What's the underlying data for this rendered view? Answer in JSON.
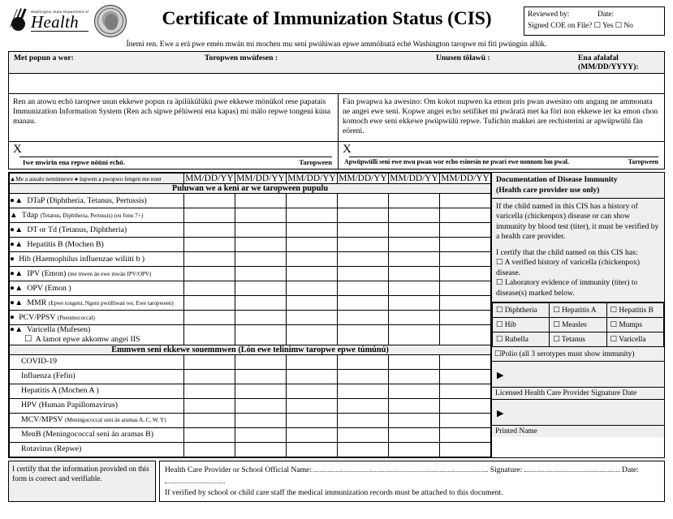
{
  "header": {
    "logo_dept": "Washington State Department of",
    "logo_name": "Health",
    "title": "Certificate of Immunization Status (CIS)",
    "subtitle": "Ínemi ren. Ewe a erá pwe emén mwán mi mochen mu seni pwúlúwan epwe ammólnatá eché Washington taropwe mi fiti pwúngún allúk.",
    "review_by_label": "Reviewed by:",
    "review_date_label": "Date:",
    "signed_coe_label": "Signed COE on File?",
    "yes_label": "Yes",
    "no_label": "No"
  },
  "form_fields": {
    "label_1": "Met popun a wor:",
    "label_2": "Toropwen mwúfesen :",
    "label_3": "Unusen tölawü :",
    "label_4": "Ena afalafal (MM/DD/YYYY):"
  },
  "attestations": {
    "left_paragraph": "Ren an atowu echö taropwe usun ekkewe popun ra äpilükülükü pwe ekkewe mönükol rese papatais Immunization Information System (Ren ach sipwe pélúweni ena kapas) mi mälo repwe tongeni kúna manau.",
    "right_paragraph": "Fän pwapwa ka awesino: Om kokot nupwen ka emon pris pwan awesino om angang ne ammonata ne angei ewe seni. Kopwe angei echo setifiket mi pwäratä met ka föri non ekkewe ier ka emon chon komoch ewe seni ekkewe pwüpwülü repwe. Tufichin makkei are rechisterini ar apwüpwülü fän eöreni.",
    "sig_x": "X",
    "left_sig_caption": "Iwe mwirin ena repwe nöüni echö.",
    "left_sig_date": "Taropween",
    "right_sig_caption": "Apwüpwülli seni ewe nwu pwan wor echo esinesin ne pwari ewe nonnom lon pwal.",
    "right_sig_date": "Taropween"
  },
  "vaccine_table": {
    "legend": "▲Me a asualo neminnewe   ● lupwen a pwopwo fengen me nour",
    "date_headers": [
      "MM/DD/YY",
      "MM/DD/YY",
      "MM/DD/YY",
      "MM/DD/YY",
      "MM/DD/YY",
      "MM/DD/YY"
    ],
    "section_required": "Puluwan we a keni ar we taropween pupulu",
    "section_other": "Emmwen seni ekkewe souemmwen (Lón ewe telinimw taropwe epwe túmúnú)",
    "required_rows": [
      {
        "marks": "●▲",
        "name": "DTaP",
        "detail": "(Diphtheria, Tetanus, Pertussis)",
        "detail_small": ""
      },
      {
        "marks": "▲",
        "name": "Tdap",
        "detail": "",
        "detail_small": "(Tetanus, Diphtheria, Pertussis) (eu fonu 7+)"
      },
      {
        "marks": "●▲",
        "name": "DT or Td",
        "detail": "(Tetanus, Diphtheria)",
        "detail_small": ""
      },
      {
        "marks": "●▲",
        "name": "Hepatitis B",
        "detail": "(Mochen B)",
        "detail_small": ""
      },
      {
        "marks": "●",
        "name": "Hib",
        "detail": "(Haemophilus influenzae wiliiti b )",
        "detail_small": ""
      },
      {
        "marks": "●▲",
        "name": "IPV",
        "detail": "(Emon)",
        "detail_small": "(me mwen án ewe mwán IPV/OPV)"
      },
      {
        "marks": "●▲",
        "name": "OPV",
        "detail": "(Emon )",
        "detail_small": ""
      },
      {
        "marks": "●▲",
        "name": "MMR",
        "detail": "",
        "detail_small": "(Epwe tongeni, Ngeni pwúlliwan we, Ewe taropween)"
      },
      {
        "marks": "●",
        "name": "PCV/PPSV",
        "detail": "",
        "detail_small": "(Pneumococcal)"
      },
      {
        "marks": "●▲",
        "name": "Varicella",
        "detail": "(Mufesen)",
        "detail_small": ""
      }
    ],
    "varicella_subcheck": "A lamot epwe akkomw angei IIS",
    "other_rows": [
      {
        "name": "COVID-19",
        "detail": "",
        "detail_small": ""
      },
      {
        "name": "Influenza",
        "detail": "(Fefin)",
        "detail_small": ""
      },
      {
        "name": "Hepatitis A",
        "detail": "(Mochen A )",
        "detail_small": ""
      },
      {
        "name": "HPV",
        "detail": "(Human Papillomavirus)",
        "detail_small": ""
      },
      {
        "name": "MCV/MPSV",
        "detail": "",
        "detail_small": "(Meningococcal seni án aramas A, C, W, Y)"
      },
      {
        "name": "MenB",
        "detail": "(Meningococcal seni án aramas B)",
        "detail_small": ""
      },
      {
        "name": "Rotavirus",
        "detail": "(Repwe)",
        "detail_small": ""
      }
    ]
  },
  "immunity_panel": {
    "heading_line1": "Documentation of Disease Immunity",
    "heading_line2": "(Health care provider use only)",
    "paragraph_1": "If the child named in this CIS has a history of varicella (chickenpox) disease or can show immunity by blood test (titer), it must be verified by a health care provider.",
    "paragraph_2": "I certify that the child named on this CIS has:",
    "check_1": "A verified history of varicella (chickenpox) disease.",
    "check_2": "Laboratory evidence of immunity (titer) to disease(s) marked below.",
    "disease_grid": [
      [
        "Diphtheria",
        "Hepatitis A",
        "Hepatitis B"
      ],
      [
        "Hib",
        "Measles",
        "Mumps"
      ],
      [
        "Rubella",
        "Tetanus",
        "Varicella"
      ]
    ],
    "polio": "Polio (all 3 serotypes must show immunity)",
    "signature_caption": "Licensed Health Care Provider Signature  Date",
    "printed_name_caption": "Printed Name",
    "arrow_glyph": "▶"
  },
  "footer": {
    "certify_text": "I certify that the information provided on this form is correct and verifiable.",
    "provider_label": "Health Care Provider or School Official Name:",
    "signature_label": "Signature:",
    "date_label": "Date:",
    "note": "If verified by school or child care staff the medical immunization records must be attached to this document."
  },
  "colors": {
    "border": "#000000",
    "shade": "#efefef",
    "background": "#ffffff"
  }
}
